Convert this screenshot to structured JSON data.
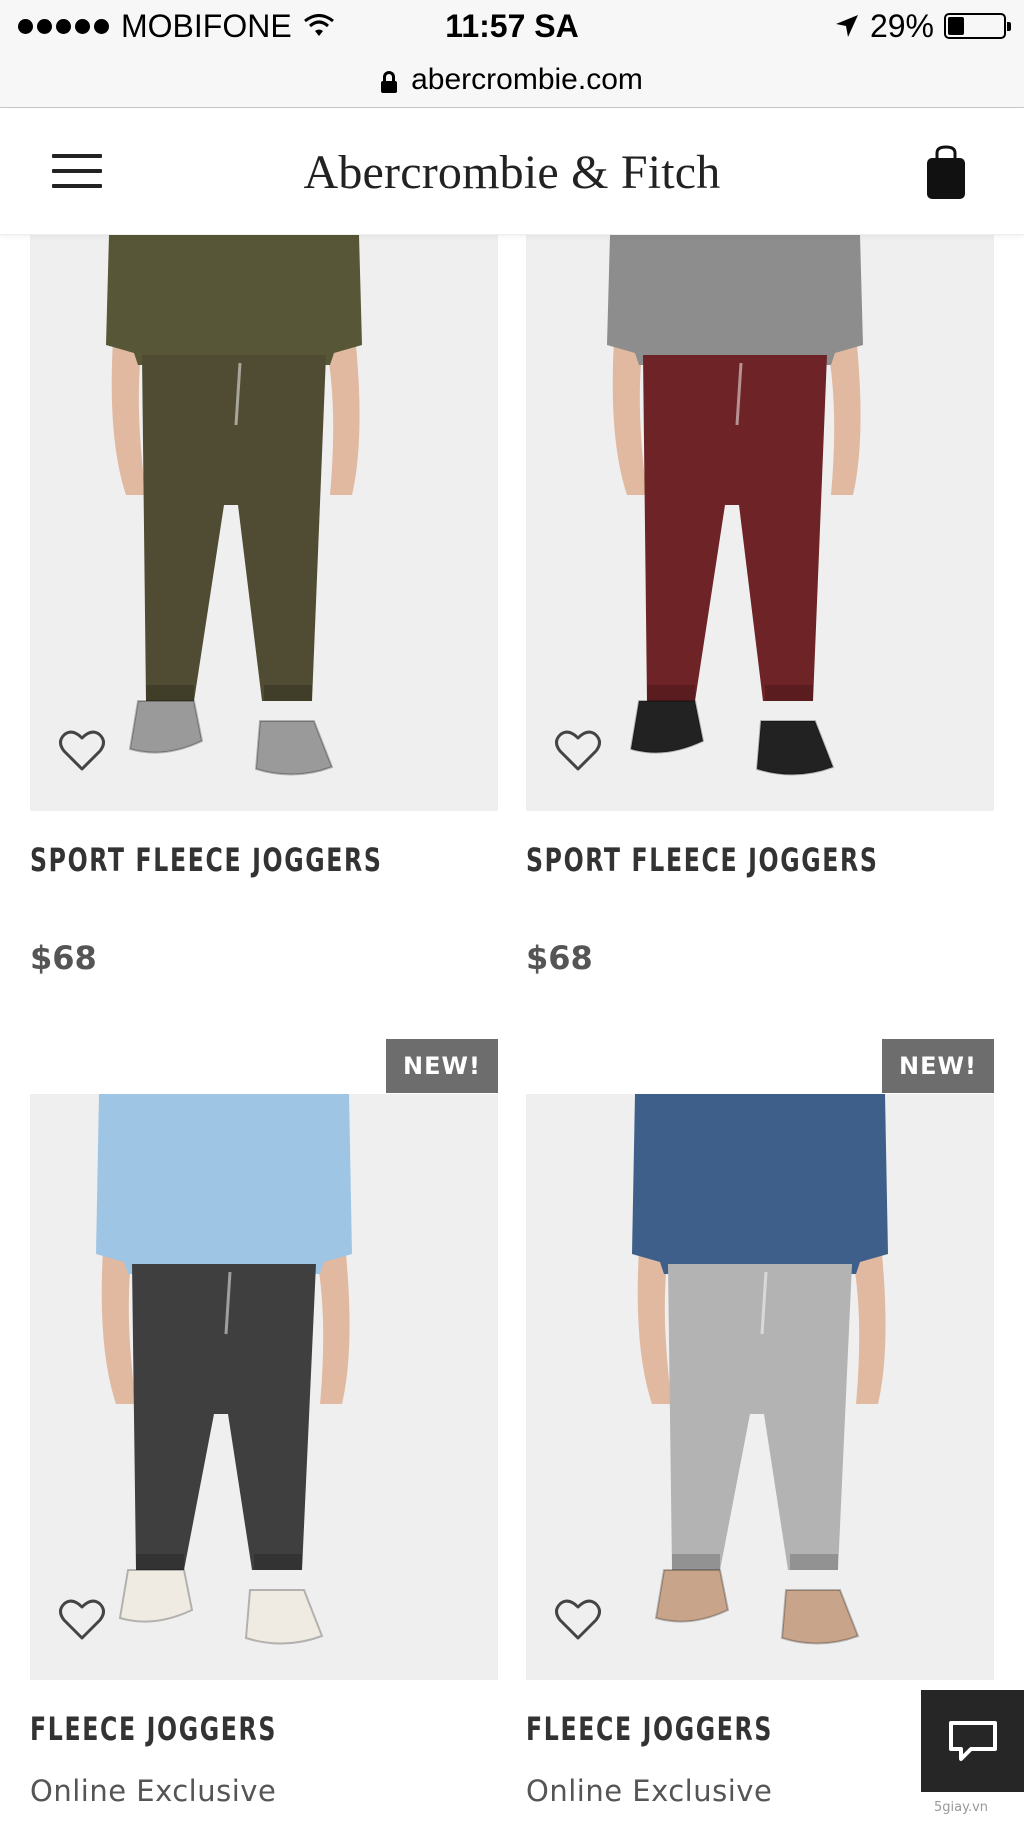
{
  "status_bar": {
    "carrier": "MOBIFONE",
    "time": "11:57 SA",
    "battery_percent": "29%",
    "battery_level": 0.29
  },
  "browser": {
    "url": "abercrombie.com"
  },
  "header": {
    "brand": "Abercrombie & Fitch",
    "menu_icon": "hamburger-menu-icon",
    "bag_icon": "shopping-bag-icon"
  },
  "products": [
    {
      "name": "SPORT FLEECE JOGGERS",
      "price": "$68",
      "color": "#4f4c33",
      "shirt": "#575636",
      "shoes": "#9a9a9a"
    },
    {
      "name": "SPORT FLEECE JOGGERS",
      "price": "$68",
      "color": "#6e2326",
      "shirt": "#8d8d8d",
      "shoes": "#222222"
    },
    {
      "name": "FLEECE JOGGERS",
      "badge": "NEW!",
      "tag": "Online Exclusive",
      "color": "#3f3f40",
      "shirt": "#9fc5e4",
      "shoes": "#efebe3"
    },
    {
      "name": "FLEECE JOGGERS",
      "badge": "NEW!",
      "tag": "Online Exclusive",
      "color": "#b3b3b3",
      "shirt": "#3e5f8a",
      "shoes": "#c8a58a"
    }
  ],
  "chat": {
    "icon": "chat-bubble-icon"
  },
  "watermark": "5giay.vn"
}
